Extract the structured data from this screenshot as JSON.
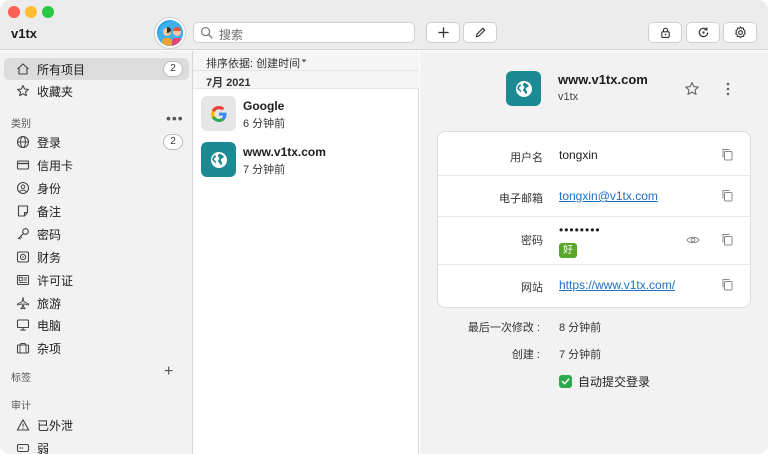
{
  "window": {
    "vault_name": "v1tx"
  },
  "toolbar": {
    "search_placeholder": "搜索",
    "add_icon": "plus-icon",
    "edit_icon": "pencil-icon",
    "lock_icon": "lock-icon",
    "sync_icon": "sync-icon",
    "settings_icon": "gear-icon"
  },
  "sidebar": {
    "all_items": {
      "label": "所有项目",
      "count": "2"
    },
    "favorites": {
      "label": "收藏夹"
    },
    "categories_title": "类别",
    "categories_more": "•••",
    "categories": [
      {
        "label": "登录",
        "icon": "globe-icon",
        "count": "2"
      },
      {
        "label": "信用卡",
        "icon": "credit-card-icon"
      },
      {
        "label": "身份",
        "icon": "identity-icon"
      },
      {
        "label": "备注",
        "icon": "note-icon"
      },
      {
        "label": "密码",
        "icon": "key-icon"
      },
      {
        "label": "财务",
        "icon": "bank-icon"
      },
      {
        "label": "许可证",
        "icon": "license-icon"
      },
      {
        "label": "旅游",
        "icon": "airplane-icon"
      },
      {
        "label": "电脑",
        "icon": "monitor-icon"
      },
      {
        "label": "杂项",
        "icon": "briefcase-icon"
      }
    ],
    "tags_title": "标签",
    "tags_add": "+",
    "audit_title": "审计",
    "audit": [
      {
        "label": "已外泄",
        "icon": "warning-icon"
      },
      {
        "label": "弱",
        "icon": "weak-icon"
      }
    ]
  },
  "list": {
    "sort_label": "排序依据: 创建时间",
    "month_header": "7月 2021",
    "items": [
      {
        "name": "Google",
        "subtitle": "6 分钟前",
        "icon": "google-icon"
      },
      {
        "name": "www.v1tx.com",
        "subtitle": "7 分钟前",
        "icon": "globe-icon"
      }
    ]
  },
  "detail": {
    "title": "www.v1tx.com",
    "subtitle": "v1tx",
    "fields": [
      {
        "key": "用户名",
        "value": "tongxin",
        "link": false
      },
      {
        "key": "电子邮箱",
        "value": "tongxin@v1tx.com",
        "link": true
      },
      {
        "key": "密码",
        "value": "••••••••",
        "strength": "好"
      },
      {
        "key": "网站",
        "value": "https://www.v1tx.com/",
        "link": true
      }
    ],
    "meta": [
      {
        "key": "最后一次修改 :",
        "value": "8 分钟前"
      },
      {
        "key": "创建 :",
        "value": "7 分钟前"
      }
    ],
    "auto_submit_label": "自动提交登录"
  },
  "colors": {
    "accent_teal": "#1b8a93",
    "link_blue": "#1f6fc1",
    "strength_good": "#58a72a",
    "check_green": "#2ca94d"
  }
}
